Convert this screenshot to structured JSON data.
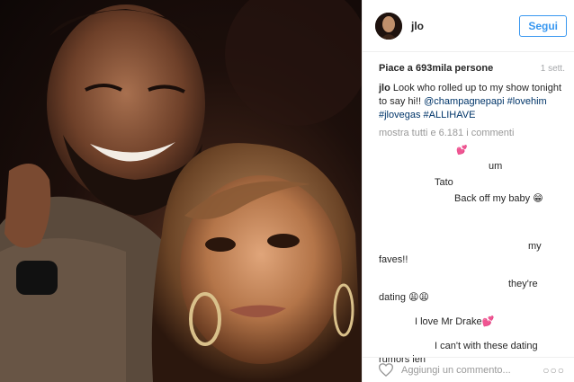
{
  "post": {
    "username": "jlo",
    "follow_label": "Segui",
    "likes": "Piace a 693mila persone",
    "time": "1 sett.",
    "caption": {
      "user": "jlo",
      "text": " Look who rolled up to my show tonight to say hi!! ",
      "mention": "@champagnepapi",
      "tags": [
        "#lovehim",
        "#jlovegas",
        "#ALLIHAVE"
      ]
    },
    "load_more": "mostra tutti e 6.181 i commenti",
    "comments": [
      {
        "text": "💕"
      },
      {
        "text": "um"
      },
      {
        "text": "Tato"
      },
      {
        "text": "Back off my baby 😁"
      },
      {
        "text": "my faves!!"
      },
      {
        "text": "they're dating 😩😩"
      },
      {
        "text": "I love Mr Drake💕"
      },
      {
        "text": "I can't with these dating rumors ien"
      }
    ],
    "add_comment_placeholder": "Aggiungi un commento...",
    "more_label": "○○○"
  },
  "colors": {
    "accent": "#3897f0",
    "hashtag": "#003569",
    "muted": "#999999"
  }
}
